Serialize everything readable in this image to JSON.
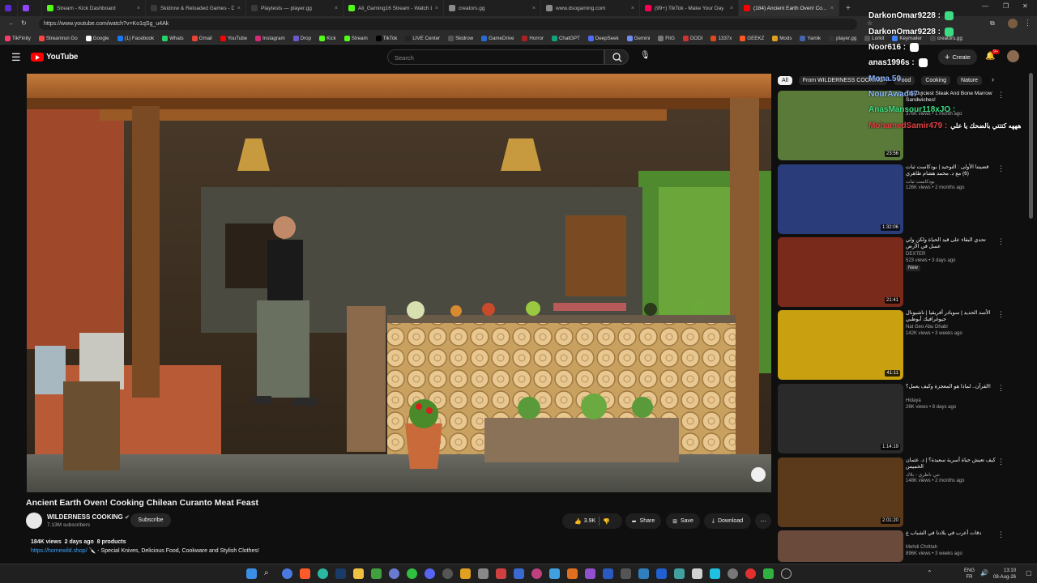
{
  "browser": {
    "tabs": [
      {
        "label": "Stream - Kick Dashboard",
        "color": "#53fc18"
      },
      {
        "label": "Skidrow & Reloaded Games - Do...",
        "color": "#3a3a3a"
      },
      {
        "label": "Playtests — player.gg",
        "color": "#3a3a3a"
      },
      {
        "label": "Ali_Gaming16 Stream - Watch Liv...",
        "color": "#53fc18"
      },
      {
        "label": "creators.gg",
        "color": "#8a8a8a"
      },
      {
        "label": "www.dsogaming.com",
        "color": "#8a8a8a"
      },
      {
        "label": "(99+) TikTok - Make Your Day",
        "color": "#ff0050"
      },
      {
        "label": "(184) Ancient Earth Oven! Co...",
        "color": "#ff0000"
      }
    ],
    "url": "https://www.youtube.com/watch?v=Ko1qSg_u4Ak",
    "bookmarks": [
      {
        "label": "TikFinity",
        "color": "#ff3b6b"
      },
      {
        "label": "Streamrun Go",
        "color": "#ff4444"
      },
      {
        "label": "Google",
        "color": "#ffffff"
      },
      {
        "label": "(1) Facebook",
        "color": "#1877f2"
      },
      {
        "label": "Whats",
        "color": "#25d366"
      },
      {
        "label": "Gmail",
        "color": "#ea4335"
      },
      {
        "label": "YouTube",
        "color": "#ff0000"
      },
      {
        "label": "Instagram",
        "color": "#d62976"
      },
      {
        "label": "Drop",
        "color": "#6a5acd"
      },
      {
        "label": "Kick",
        "color": "#53fc18"
      },
      {
        "label": "Stream",
        "color": "#53fc18"
      },
      {
        "label": "TikTok",
        "color": "#000000"
      },
      {
        "label": "LIVE Center",
        "color": "#222222"
      },
      {
        "label": "Skidrow",
        "color": "#555555"
      },
      {
        "label": "GameDrive",
        "color": "#2a6bd1"
      },
      {
        "label": "Horror",
        "color": "#aa2222"
      },
      {
        "label": "ChatGPT",
        "color": "#10a37f"
      },
      {
        "label": "DeepSeek",
        "color": "#4d6bfe"
      },
      {
        "label": "Gemini",
        "color": "#6d8df5"
      },
      {
        "label": "FitG",
        "color": "#777777"
      },
      {
        "label": "DODI",
        "color": "#cc3333"
      },
      {
        "label": "1337x",
        "color": "#e04a1a"
      },
      {
        "label": "GEEKZ",
        "color": "#ff5722"
      },
      {
        "label": "Mods",
        "color": "#e0a020"
      },
      {
        "label": "Yamik",
        "color": "#4466aa"
      },
      {
        "label": "player.gg",
        "color": "#333333"
      },
      {
        "label": "Lorkit",
        "color": "#555555"
      },
      {
        "label": "Keymailer",
        "color": "#3b82f6"
      },
      {
        "label": "creators.gg",
        "color": "#444444"
      }
    ]
  },
  "youtube": {
    "logo": "YouTube",
    "search_placeholder": "Search",
    "create_label": "Create",
    "notif_count": "9+"
  },
  "video": {
    "title": "Ancient Earth Oven! Cooking Chilean Curanto Meat Feast",
    "channel": "WILDERNESS COOKING",
    "subscribers": "7.13M subscribers",
    "subscribe_label": "Subscribe",
    "likes": "3.9K",
    "share_label": "Share",
    "save_label": "Save",
    "download_label": "Download",
    "views": "184K views",
    "age": "2 days ago",
    "products": "8 products",
    "desc_link": "https://homewild.shop/",
    "desc_text": "🔪 - Special Knives, Delicious Food, Cookware and Stylish Clothes!"
  },
  "sidebar": {
    "chips": [
      "All",
      "From WILDERNESS COOKING",
      "Food",
      "Cooking",
      "Nature"
    ],
    "items": [
      {
        "title": "The Juiciest Steak And Bone Marrow Sandwiches!",
        "channel": "",
        "views": "376K views • 1 month ago",
        "duration": "23:56",
        "color": "#5a7a3a"
      },
      {
        "title": "قضيتنا الأولى : التوحيد | بودكاست ثبات (6) مع د. محمد هشام طاهري",
        "channel": "بودكاست ثبات",
        "views": "126K views • 2 months ago",
        "duration": "1:32:06",
        "color": "#2a3d7a"
      },
      {
        "title": "تحدي البقاء على قيد الحياة ولكن ولي عسل في الأرض",
        "channel": "DEXTER",
        "views": "523 views • 3 days ago",
        "badge": "New",
        "duration": "21:41",
        "color": "#7a2a1a"
      },
      {
        "title": "الأسد الحديد | سوبادر أفريقيا | ناشيونال جيوغرافيك أبوظبي",
        "channel": "Nat Geo Abu Dhabi",
        "views": "142K views • 3 weeks ago",
        "duration": "41:11",
        "color": "#c8a010"
      },
      {
        "title": "القرآن.. لماذا هو المعجزة وكيف يعمل؟!",
        "channel": "Hidaya",
        "views": "26K views • 8 days ago",
        "duration": "1:14:19",
        "color": "#2a2a2a"
      },
      {
        "title": "كيف تعيش حياة أسرية سعيدة؟ | د. عثمان الخميس",
        "channel": "تبي ناظري - بلاك",
        "views": "148K views • 2 months ago",
        "duration": "2:01:20",
        "color": "#5a3a1a"
      },
      {
        "title": "دقات أعرب في بلادنا في الشباب ع",
        "channel": "Mehdi Chrittah",
        "views": "896K views • 3 weeks ago",
        "duration": "",
        "color": "#6a4a3a"
      }
    ]
  },
  "chat": [
    {
      "user": "DarkonOmar9228 :",
      "msg": "",
      "color": "#ffffff",
      "bg": "#3ddc84"
    },
    {
      "user": "DarkonOmar9228 :",
      "msg": "",
      "color": "#ffffff",
      "bg": "#3ddc84"
    },
    {
      "user": "Noor616 :",
      "msg": "",
      "color": "#ffffff",
      "bg": "#ffffff"
    },
    {
      "user": "anas1996s :",
      "msg": "",
      "color": "#ffffff",
      "bg": "#ffffff"
    },
    {
      "user": "Mona.50",
      "msg": "",
      "color": "#8ab4ff",
      "bg": ""
    },
    {
      "user": "NourAwad47 :",
      "msg": "",
      "color": "#8ab4ff",
      "bg": ""
    },
    {
      "user": "AnasMansour118xJO :",
      "msg": "",
      "color": "#3ddc84",
      "bg": ""
    },
    {
      "user": "MohamedSamir479 :",
      "msg": "هههه كتتتي بالضحك يا علي",
      "color": "#e04040",
      "bg": ""
    }
  ],
  "taskbar": {
    "lang": "ENG",
    "region": "FR",
    "time": "13:10",
    "date": "08-Aug-26"
  }
}
